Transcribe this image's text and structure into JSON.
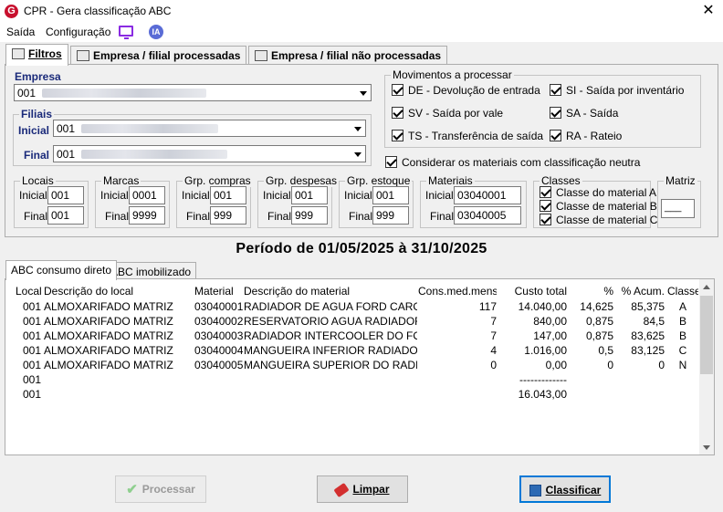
{
  "window": {
    "title": "CPR - Gera classificação ABC",
    "close_glyph": "✕",
    "app_icon": "G"
  },
  "menu": {
    "saida": "Saída",
    "configuracao": "Configuração",
    "ia": "IA"
  },
  "tabs": {
    "filtros": "Filtros",
    "processadas": "Empresa / filial processadas",
    "nao_processadas": "Empresa / filial não processadas"
  },
  "empresa": {
    "label": "Empresa",
    "code": "001"
  },
  "filiais": {
    "label": "Filiais",
    "inicial_label": "Inicial",
    "inicial_code": "001",
    "final_label": "Final",
    "final_code": "001"
  },
  "movimentos": {
    "title": "Movimentos a processar",
    "items": [
      "DE - Devolução de entrada",
      "SI - Saída por inventário",
      "SV - Saída por vale",
      "SA - Saída",
      "TS - Transferência de saída",
      "RA - Rateio"
    ],
    "neutra": "Considerar os materiais com classificação neutra"
  },
  "ranges": {
    "inicial": "Inicial",
    "final": "Final",
    "locais": {
      "title": "Locais",
      "ini": "001",
      "fim": "001"
    },
    "marcas": {
      "title": "Marcas",
      "ini": "0001",
      "fim": "9999"
    },
    "grp_compras": {
      "title": "Grp. compras",
      "ini": "001",
      "fim": "999"
    },
    "grp_despesas": {
      "title": "Grp. despesas",
      "ini": "001",
      "fim": "999"
    },
    "grp_estoque": {
      "title": "Grp. estoque",
      "ini": "001",
      "fim": "999"
    },
    "materiais": {
      "title": "Materiais",
      "ini": "03040001",
      "fim": "03040005"
    }
  },
  "classes": {
    "title": "Classes",
    "a": "Classe do material A",
    "b": "Classe de material B",
    "c": "Classe de material C"
  },
  "matriz": {
    "title": "Matriz",
    "value": "___"
  },
  "periodo": "Período de 01/05/2025  à 31/10/2025",
  "result_tabs": {
    "consumo": "ABC consumo direto",
    "imobilizado": "ABC imobilizado"
  },
  "table": {
    "headers": [
      "Local",
      "Descrição do local",
      "Material",
      "Descrição do material",
      "Cons.med.mensal",
      "Custo total",
      "%",
      "% Acum.",
      "Classe"
    ],
    "rows": [
      [
        "001",
        "ALMOXARIFADO MATRIZ",
        "03040001",
        "RADIADOR DE AGUA FORD CARGO -",
        "117",
        "14.040,00",
        "14,625",
        "85,375",
        "A"
      ],
      [
        "001",
        "ALMOXARIFADO MATRIZ",
        "03040002",
        "RESERVATORIO AGUA RADIADOR C",
        "7",
        "840,00",
        "0,875",
        "84,5",
        "B"
      ],
      [
        "001",
        "ALMOXARIFADO MATRIZ",
        "03040003",
        "RADIADOR INTERCOOLER  DO FORD",
        "7",
        "147,00",
        "0,875",
        "83,625",
        "B"
      ],
      [
        "001",
        "ALMOXARIFADO MATRIZ",
        "03040004",
        "MANGUEIRA INFERIOR RADIADOR C",
        "4",
        "1.016,00",
        "0,5",
        "83,125",
        "C"
      ],
      [
        "001",
        "ALMOXARIFADO MATRIZ",
        "03040005",
        "MANGUEIRA SUPERIOR DO RADIADO",
        "0",
        "0,00",
        "0",
        "0",
        "N"
      ]
    ],
    "footer_rows": [
      {
        "local": "001",
        "custo": "-------------"
      },
      {
        "local": "001",
        "custo": "16.043,00"
      }
    ]
  },
  "buttons": {
    "processar": "Processar",
    "limpar": "Limpar",
    "classificar": "Classificar"
  }
}
